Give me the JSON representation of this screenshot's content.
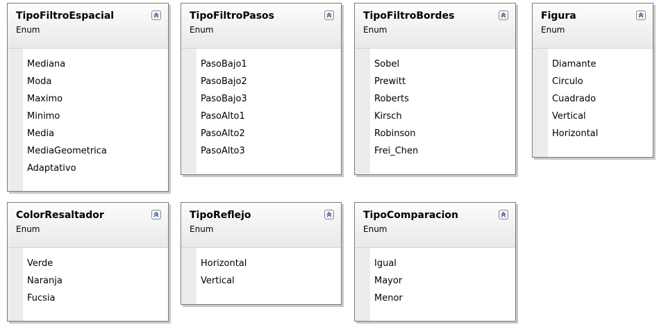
{
  "enums": [
    {
      "name": "TipoFiltroEspacial",
      "kind": "Enum",
      "values": [
        "Mediana",
        "Moda",
        "Maximo",
        "Minimo",
        "Media",
        "MediaGeometrica",
        "Adaptativo"
      ]
    },
    {
      "name": "TipoFiltroPasos",
      "kind": "Enum",
      "values": [
        "PasoBajo1",
        "PasoBajo2",
        "PasoBajo3",
        "PasoAlto1",
        "PasoAlto2",
        "PasoAlto3"
      ]
    },
    {
      "name": "TipoFiltroBordes",
      "kind": "Enum",
      "values": [
        "Sobel",
        "Prewitt",
        "Roberts",
        "Kirsch",
        "Robinson",
        "Frei_Chen"
      ]
    },
    {
      "name": "Figura",
      "kind": "Enum",
      "values": [
        "Diamante",
        "Circulo",
        "Cuadrado",
        "Vertical",
        "Horizontal"
      ]
    },
    {
      "name": "ColorResaltador",
      "kind": "Enum",
      "values": [
        "Verde",
        "Naranja",
        "Fucsia"
      ]
    },
    {
      "name": "TipoReflejo",
      "kind": "Enum",
      "values": [
        "Horizontal",
        "Vertical"
      ]
    },
    {
      "name": "TipoComparacion",
      "kind": "Enum",
      "values": [
        "Igual",
        "Mayor",
        "Menor"
      ]
    }
  ],
  "icons": {
    "collapse": "collapse-chevrons-icon"
  },
  "colors": {
    "border": "#7a7a7a",
    "stripe": "#ececec"
  }
}
